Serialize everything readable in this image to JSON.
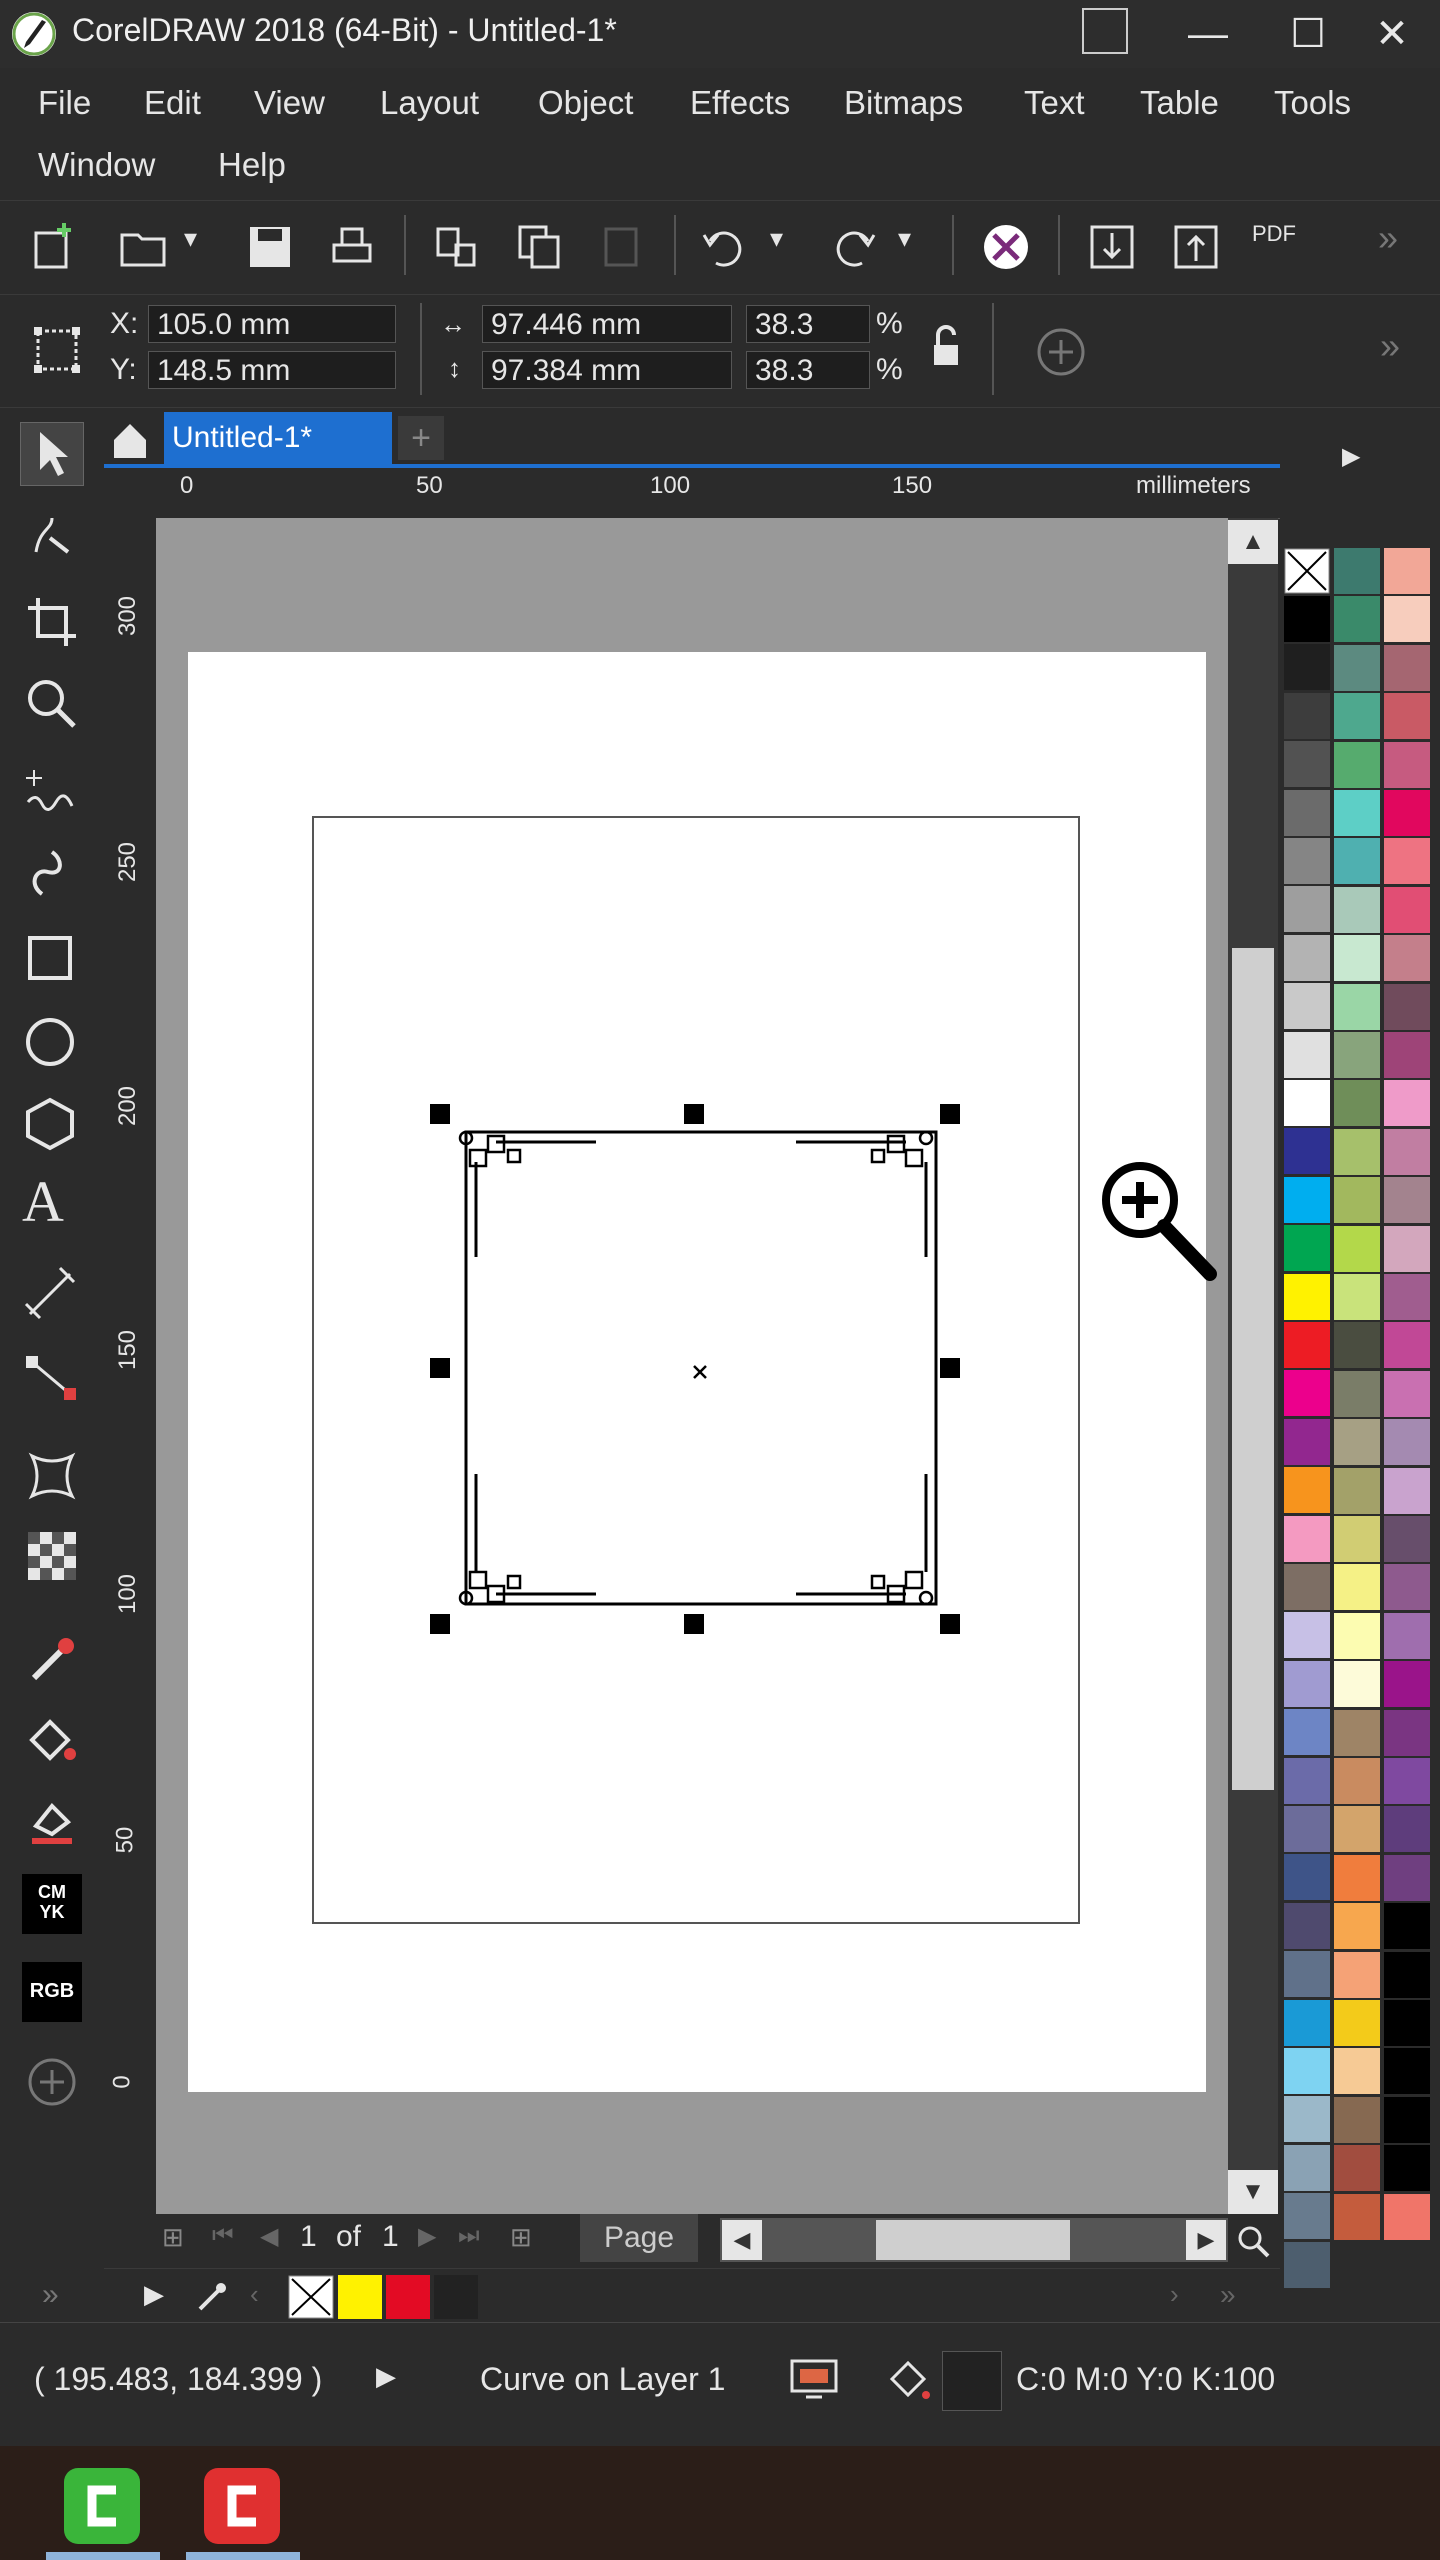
{
  "window": {
    "title": "CorelDRAW 2018 (64-Bit) - Untitled-1*",
    "minimize": "—",
    "maximize": "☐",
    "close": "✕"
  },
  "menu": [
    "File",
    "Edit",
    "View",
    "Layout",
    "Object",
    "Effects",
    "Bitmaps",
    "Text",
    "Table",
    "Tools",
    "Window",
    "Help"
  ],
  "toolbar": {
    "pdf_label": "PDF",
    "overflow": "»"
  },
  "property_bar": {
    "x_label": "X:",
    "x_value": "105.0 mm",
    "y_label": "Y:",
    "y_value": "148.5 mm",
    "width_value": "97.446 mm",
    "height_value": "97.384 mm",
    "scale_x": "38.3",
    "scale_y": "38.3",
    "percent": "%",
    "overflow": "»"
  },
  "document": {
    "tab_label": "Untitled-1*",
    "add_tab": "+",
    "ruler_units": "millimeters",
    "h_ticks": [
      "0",
      "50",
      "100",
      "150"
    ],
    "v_ticks": [
      "300",
      "250",
      "200",
      "150",
      "100",
      "50",
      "0"
    ]
  },
  "page_nav": {
    "current": "1",
    "of": "of",
    "total": "1",
    "page_tab": "Page"
  },
  "status": {
    "coords": "( 195.483, 184.399 )",
    "object_info": "Curve on Layer 1",
    "fill_info": "C:0 M:0 Y:0 K:100"
  },
  "colors": {
    "accent": "#1e6fd0",
    "ui_bg": "#2b2b2b",
    "canvas_bg": "#999999"
  },
  "palette": {
    "col1": [
      "#000000",
      "#1f1f1f",
      "#3d3d3d",
      "#525252",
      "#6b6b6b",
      "#858585",
      "#9e9e9e",
      "#b3b3b3",
      "#c9c9c9",
      "#e0e0e0",
      "#ffffff",
      "#2e3192",
      "#00aeef",
      "#00a651",
      "#fff200",
      "#ed1c24",
      "#ec008c",
      "#92278f",
      "#f7941d",
      "#f49ac1",
      "#7d6e64",
      "#c7c0e6",
      "#a09bd1",
      "#6d85c5",
      "#6b6ba9",
      "#6c6c9a",
      "#3e5488",
      "#4f4a6e",
      "#60718a",
      "#1a9ad6",
      "#7ed3f2",
      "#9bb8c9",
      "#8aa2b4",
      "#687b8e",
      "#4d5e6e"
    ],
    "col2": [
      "#3d7a6e",
      "#3a8a6a",
      "#5c8a80",
      "#4ea88e",
      "#56ab6e",
      "#5dcfc6",
      "#4fb0b0",
      "#a9c9b9",
      "#c8e8d0",
      "#9ad6a6",
      "#88a47c",
      "#6f8e59",
      "#a6c06b",
      "#a2b85e",
      "#b3d84a",
      "#c9e37b",
      "#4a4d40",
      "#7a7d68",
      "#a6a084",
      "#a3a169",
      "#d1cd73",
      "#f5f186",
      "#fcfcb1",
      "#fdfbd9",
      "#9e8466",
      "#c98b60",
      "#d3a46b",
      "#f07d3d",
      "#f7a74e",
      "#f5a276",
      "#f3cb1a",
      "#f6ca95",
      "#866951",
      "#a14d3f",
      "#c45c3d"
    ],
    "col3": [
      "#f2a797",
      "#f7cdbd",
      "#a56671",
      "#c95a65",
      "#c65b80",
      "#e1075e",
      "#ee7382",
      "#e14e74",
      "#c47f8b",
      "#704b5c",
      "#9e4478",
      "#ef9bc9",
      "#c17ea2",
      "#a3838e",
      "#d3a7bd",
      "#a05d8f",
      "#c14896",
      "#c970b1",
      "#a48ab1",
      "#c9a3ce",
      "#674e6b",
      "#8e5a8e",
      "#9f6eae",
      "#9a148a",
      "#7a3582",
      "#7f49a0",
      "#5e3d7c",
      "#6f3f80",
      "#000000",
      "#000000",
      "#000000",
      "#000000",
      "#000000",
      "#000000",
      "#f07569"
    ]
  }
}
